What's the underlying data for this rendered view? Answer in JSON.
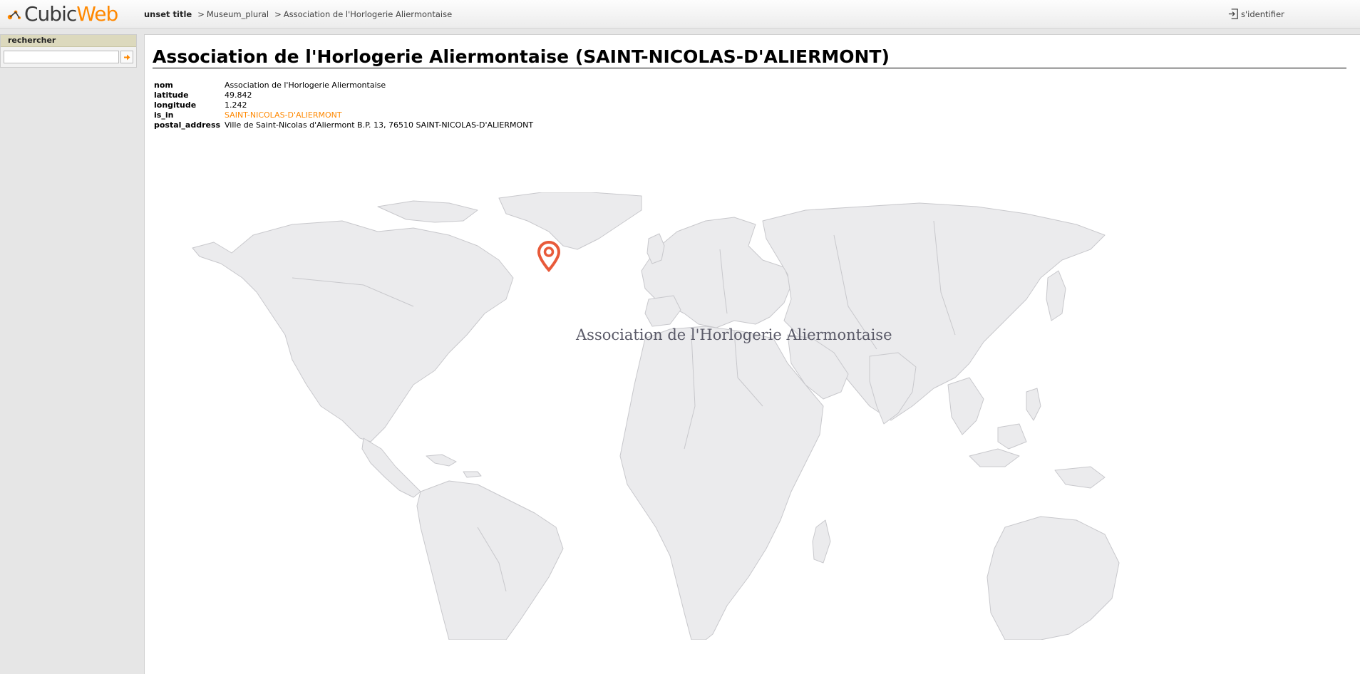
{
  "header": {
    "logo_part1": "Cubic",
    "logo_part2": "Web",
    "site_title": "unset title",
    "breadcrumb": [
      {
        "label": "Museum_plural"
      },
      {
        "label": "Association de l'Horlogerie Aliermontaise"
      }
    ],
    "login_label": "s'identifier",
    "login_icon": "login-icon"
  },
  "sidebar": {
    "search_title": "rechercher",
    "search_value": "",
    "search_button_icon": "arrow-right-icon"
  },
  "main": {
    "title": "Association de l'Horlogerie Aliermontaise (SAINT-NICOLAS-D'ALIERMONT)",
    "attributes": [
      {
        "key": "nom",
        "value": "Association de l'Horlogerie Aliermontaise"
      },
      {
        "key": "latitude",
        "value": "49.842"
      },
      {
        "key": "longitude",
        "value": "1.242"
      },
      {
        "key": "is_in",
        "value": "SAINT-NICOLAS-D'ALIERMONT"
      },
      {
        "key": "postal_address",
        "value": "Ville de Saint-Nicolas d'Aliermont B.P. 13, 76510 SAINT-NICOLAS-D'ALIERMONT"
      }
    ],
    "map": {
      "marker_label": "Association de l'Horlogerie Aliermontaise",
      "marker_icon": "map-pin-icon",
      "marker_color": "#e85a3a",
      "land_color": "#ebebed",
      "border_color": "#c8c8cc"
    }
  },
  "colors": {
    "accent": "#ff8800",
    "link": "#ff8800"
  }
}
